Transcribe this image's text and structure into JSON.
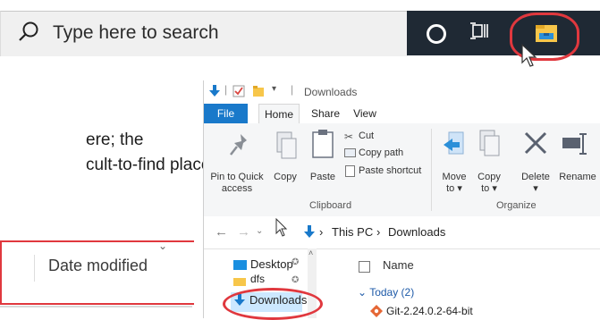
{
  "taskbar": {
    "search_placeholder": "Type here to search"
  },
  "slide": {
    "line1": "ere; the",
    "line2": "cult-to-find  place"
  },
  "zoom_header": {
    "column": "Date modified"
  },
  "explorer": {
    "title": "Downloads",
    "tabs": [
      "File",
      "Home",
      "Share",
      "View"
    ],
    "ribbon": {
      "pin": "Pin to Quick access",
      "copy": "Copy",
      "paste": "Paste",
      "cut": "Cut",
      "copy_path": "Copy path",
      "paste_shortcut": "Paste shortcut",
      "clipboard_group": "Clipboard",
      "move_to": "Move to",
      "copy_to": "Copy to",
      "delete": "Delete",
      "rename": "Rename",
      "organize_group": "Organize"
    },
    "address": {
      "crumbs": [
        "This PC",
        "Downloads"
      ]
    },
    "nav": [
      "Desktop",
      "dfs",
      "Downloads"
    ],
    "list": {
      "column": "Name",
      "group": "Today (2)",
      "files": [
        "Git-2.24.0.2-64-bit"
      ]
    },
    "colors": {
      "accent": "#1979ca",
      "highlight": "#e0383e"
    }
  }
}
